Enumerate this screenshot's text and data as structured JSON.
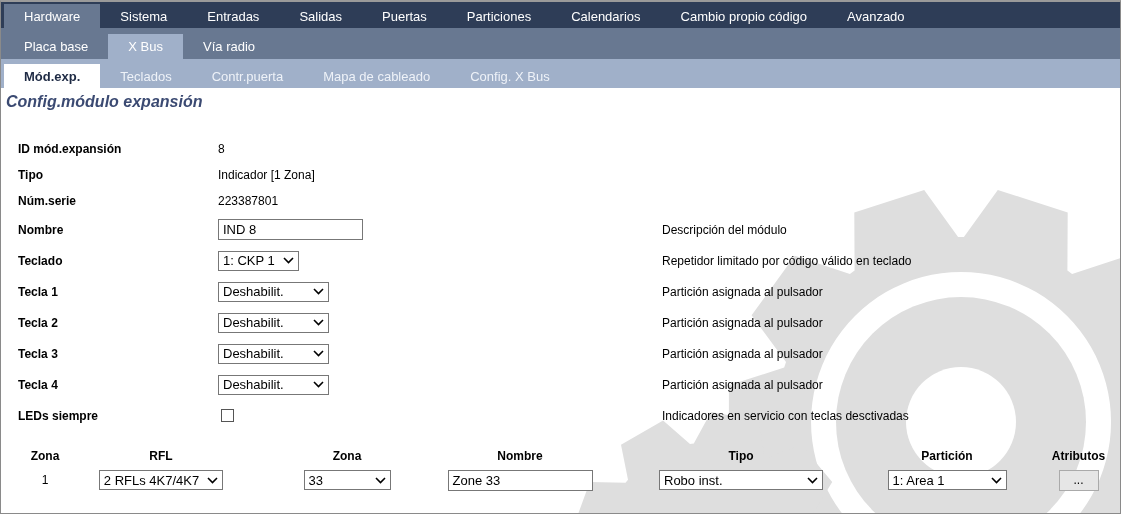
{
  "main_tabs": [
    {
      "label": "Hardware",
      "selected": true
    },
    {
      "label": "Sistema",
      "selected": false
    },
    {
      "label": "Entradas",
      "selected": false
    },
    {
      "label": "Salidas",
      "selected": false
    },
    {
      "label": "Puertas",
      "selected": false
    },
    {
      "label": "Particiones",
      "selected": false
    },
    {
      "label": "Calendarios",
      "selected": false
    },
    {
      "label": "Cambio propio código",
      "selected": false
    },
    {
      "label": "Avanzado",
      "selected": false
    }
  ],
  "sub_tabs": [
    {
      "label": "Placa base",
      "selected": false
    },
    {
      "label": "X Bus",
      "selected": true
    },
    {
      "label": "Vía radio",
      "selected": false
    }
  ],
  "section_tabs": [
    {
      "label": "Mód.exp.",
      "selected": true
    },
    {
      "label": "Teclados",
      "selected": false
    },
    {
      "label": "Contr.puerta",
      "selected": false
    },
    {
      "label": "Mapa de cableado",
      "selected": false
    },
    {
      "label": "Config. X Bus",
      "selected": false
    }
  ],
  "section_title": "Config.módulo expansión",
  "fields": [
    {
      "label": "ID mód.expansión",
      "kind": "text",
      "value": "8"
    },
    {
      "label": "Tipo",
      "kind": "text",
      "value": "Indicador [1 Zona]"
    },
    {
      "label": "Núm.serie",
      "kind": "text",
      "value": "223387801"
    },
    {
      "label": "Nombre",
      "kind": "input",
      "value": "IND 8",
      "description": "Descripción del módulo"
    },
    {
      "label": "Teclado",
      "kind": "select",
      "value": "1: CKP 1",
      "description": "Repetidor limitado por código válido en teclado"
    },
    {
      "label": "Tecla 1",
      "kind": "select",
      "value": "Deshabilit.",
      "description": "Partición asignada al pulsador"
    },
    {
      "label": "Tecla 2",
      "kind": "select",
      "value": "Deshabilit.",
      "description": "Partición asignada al pulsador"
    },
    {
      "label": "Tecla 3",
      "kind": "select",
      "value": "Deshabilit.",
      "description": "Partición asignada al pulsador"
    },
    {
      "label": "Tecla 4",
      "kind": "select",
      "value": "Deshabilit.",
      "description": "Partición asignada al pulsador"
    },
    {
      "label": "LEDs siempre",
      "kind": "checkbox",
      "checked": false,
      "description": "Indicadores en servicio con teclas desctivadas"
    }
  ],
  "zones_table": {
    "columns": [
      "Zona",
      "RFL",
      "Zona",
      "Nombre",
      "Tipo",
      "Partición",
      "Atributos"
    ],
    "rows": [
      {
        "zone_number": "1",
        "rfl": "2 RFLs 4K7/4K7",
        "zone": "33",
        "name": "Zone 33",
        "type": "Robo inst.",
        "partition": "1: Area 1",
        "attributes_button": "..."
      }
    ]
  }
}
